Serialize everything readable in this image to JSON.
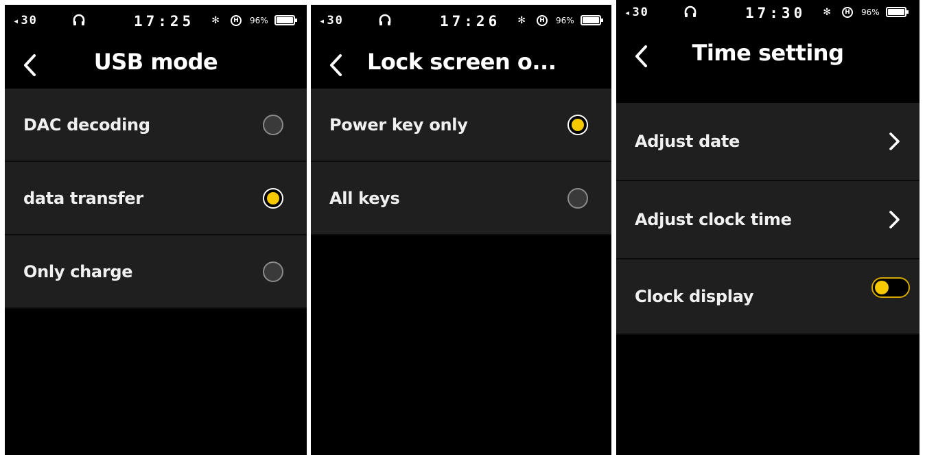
{
  "status_bars": [
    {
      "volume": "30",
      "time": "17:25",
      "battery_pct": "96%"
    },
    {
      "volume": "30",
      "time": "17:26",
      "battery_pct": "96%"
    },
    {
      "volume": "30",
      "time": "17:30",
      "battery_pct": "96%"
    }
  ],
  "icons": {
    "speaker": "◂",
    "bluetooth": "✻",
    "hires": "H"
  },
  "colors": {
    "accent": "#f5c800",
    "row_bg": "#1f1f1f",
    "screen_bg": "#000000"
  },
  "usb_mode": {
    "title": "USB mode",
    "options": [
      {
        "label": "DAC decoding",
        "selected": false
      },
      {
        "label": "data transfer",
        "selected": true
      },
      {
        "label": "Only charge",
        "selected": false
      }
    ]
  },
  "lock_screen": {
    "title": "Lock screen o...",
    "options": [
      {
        "label": "Power key only",
        "selected": true
      },
      {
        "label": "All keys",
        "selected": false
      }
    ]
  },
  "time_setting": {
    "title": "Time setting",
    "items": [
      {
        "label": "Adjust date"
      },
      {
        "label": "Adjust clock time"
      },
      {
        "label": "Clock display",
        "toggle_on": false
      }
    ]
  }
}
